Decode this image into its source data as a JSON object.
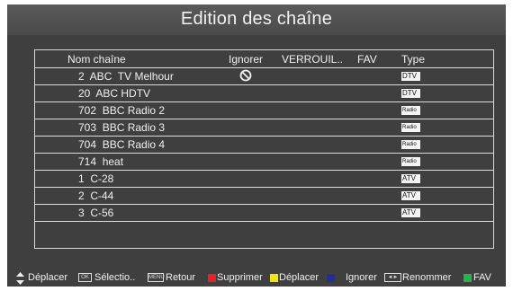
{
  "title": "Edition des chaîne",
  "columns": {
    "name": "Nom chaîne",
    "ignore": "Ignorer",
    "lock": "VERROUIL..",
    "fav": "FAV",
    "type": "Type"
  },
  "channels": [
    {
      "name": "2  ABC  TV Melhour",
      "ignored": true,
      "type": "DTV"
    },
    {
      "name": "20  ABC HDTV",
      "ignored": false,
      "type": "DTV"
    },
    {
      "name": "702  BBC Radio 2",
      "ignored": false,
      "type": "Radio"
    },
    {
      "name": "703  BBC Radio 3",
      "ignored": false,
      "type": "Radio"
    },
    {
      "name": "704  BBC Radio 4",
      "ignored": false,
      "type": "Radio"
    },
    {
      "name": "714  heat",
      "ignored": false,
      "type": "Radio"
    },
    {
      "name": "1  C-28",
      "ignored": false,
      "type": "ATV"
    },
    {
      "name": "2  C-44",
      "ignored": false,
      "type": "ATV"
    },
    {
      "name": "3  C-56",
      "ignored": false,
      "type": "ATV"
    }
  ],
  "footer": {
    "move": "Déplacer",
    "ok_key": "OK",
    "select": "Sélectio..",
    "return_key": "MENU",
    "return": "Retour",
    "delete": "Supprimer",
    "move2": "Déplacer",
    "ignore": "Ignorer",
    "rename_key": "◄►",
    "rename": "Renommer",
    "fav": "FAV"
  },
  "colors": {
    "red": "#e8202a",
    "yellow": "#f2e21a",
    "blue": "#2a2a9a",
    "green": "#27b24a"
  }
}
